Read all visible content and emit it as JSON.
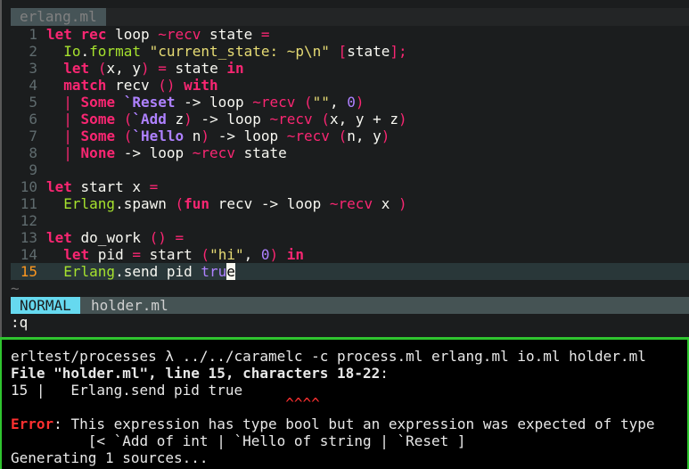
{
  "editor": {
    "tab_filename": "erlang.ml",
    "tilde": "~",
    "lines": [
      {
        "num": "1",
        "tokens": [
          {
            "t": "let",
            "c": "kw"
          },
          {
            "t": " "
          },
          {
            "t": "rec",
            "c": "kw"
          },
          {
            "t": " loop "
          },
          {
            "t": "~recv",
            "c": "op"
          },
          {
            "t": " state "
          },
          {
            "t": "=",
            "c": "op"
          }
        ]
      },
      {
        "num": "2",
        "tokens": [
          {
            "t": "  "
          },
          {
            "t": "Io",
            "c": "mod"
          },
          {
            "t": "."
          },
          {
            "t": "format",
            "c": "mod"
          },
          {
            "t": " "
          },
          {
            "t": "\"current_state: ~p\\n\"",
            "c": "str"
          },
          {
            "t": " "
          },
          {
            "t": "[",
            "c": "punc"
          },
          {
            "t": "state"
          },
          {
            "t": "];",
            "c": "punc"
          }
        ]
      },
      {
        "num": "3",
        "tokens": [
          {
            "t": "  "
          },
          {
            "t": "let",
            "c": "kw"
          },
          {
            "t": " "
          },
          {
            "t": "(",
            "c": "punc"
          },
          {
            "t": "x, y"
          },
          {
            "t": ")",
            "c": "punc"
          },
          {
            "t": " "
          },
          {
            "t": "=",
            "c": "op"
          },
          {
            "t": " state "
          },
          {
            "t": "in",
            "c": "kw"
          }
        ]
      },
      {
        "num": "4",
        "tokens": [
          {
            "t": "  "
          },
          {
            "t": "match",
            "c": "kw"
          },
          {
            "t": " recv "
          },
          {
            "t": "()",
            "c": "punc"
          },
          {
            "t": " "
          },
          {
            "t": "with",
            "c": "kw"
          }
        ]
      },
      {
        "num": "5",
        "tokens": [
          {
            "t": "  "
          },
          {
            "t": "|",
            "c": "op"
          },
          {
            "t": " "
          },
          {
            "t": "Some",
            "c": "kw"
          },
          {
            "t": " "
          },
          {
            "t": "`Reset",
            "c": "ctor"
          },
          {
            "t": " -> loop "
          },
          {
            "t": "~recv",
            "c": "op"
          },
          {
            "t": " "
          },
          {
            "t": "(",
            "c": "punc"
          },
          {
            "t": "\"\"",
            "c": "str"
          },
          {
            "t": ", "
          },
          {
            "t": "0",
            "c": "num"
          },
          {
            "t": ")",
            "c": "punc"
          }
        ]
      },
      {
        "num": "6",
        "tokens": [
          {
            "t": "  "
          },
          {
            "t": "|",
            "c": "op"
          },
          {
            "t": " "
          },
          {
            "t": "Some",
            "c": "kw"
          },
          {
            "t": " "
          },
          {
            "t": "(",
            "c": "punc"
          },
          {
            "t": "`Add",
            "c": "ctor"
          },
          {
            "t": " z"
          },
          {
            "t": ")",
            "c": "punc"
          },
          {
            "t": " -> loop "
          },
          {
            "t": "~recv",
            "c": "op"
          },
          {
            "t": " "
          },
          {
            "t": "(",
            "c": "punc"
          },
          {
            "t": "x, y + z"
          },
          {
            "t": ")",
            "c": "punc"
          }
        ]
      },
      {
        "num": "7",
        "tokens": [
          {
            "t": "  "
          },
          {
            "t": "|",
            "c": "op"
          },
          {
            "t": " "
          },
          {
            "t": "Some",
            "c": "kw"
          },
          {
            "t": " "
          },
          {
            "t": "(",
            "c": "punc"
          },
          {
            "t": "`Hello",
            "c": "ctor"
          },
          {
            "t": " n"
          },
          {
            "t": ")",
            "c": "punc"
          },
          {
            "t": " -> loop "
          },
          {
            "t": "~recv",
            "c": "op"
          },
          {
            "t": " "
          },
          {
            "t": "(",
            "c": "punc"
          },
          {
            "t": "n, y"
          },
          {
            "t": ")",
            "c": "punc"
          }
        ]
      },
      {
        "num": "8",
        "tokens": [
          {
            "t": "  "
          },
          {
            "t": "|",
            "c": "op"
          },
          {
            "t": " "
          },
          {
            "t": "None",
            "c": "kw"
          },
          {
            "t": " -> loop "
          },
          {
            "t": "~recv",
            "c": "op"
          },
          {
            "t": " state"
          }
        ]
      },
      {
        "num": "9",
        "tokens": []
      },
      {
        "num": "10",
        "tokens": [
          {
            "t": "let",
            "c": "kw"
          },
          {
            "t": " start x "
          },
          {
            "t": "=",
            "c": "op"
          }
        ]
      },
      {
        "num": "11",
        "tokens": [
          {
            "t": "  "
          },
          {
            "t": "Erlang",
            "c": "mod"
          },
          {
            "t": ".spawn "
          },
          {
            "t": "(",
            "c": "punc"
          },
          {
            "t": "fun",
            "c": "kw"
          },
          {
            "t": " recv -> loop "
          },
          {
            "t": "~recv",
            "c": "op"
          },
          {
            "t": " x "
          },
          {
            "t": ")",
            "c": "punc"
          }
        ]
      },
      {
        "num": "12",
        "tokens": []
      },
      {
        "num": "13",
        "tokens": [
          {
            "t": "let",
            "c": "kw"
          },
          {
            "t": " do_work "
          },
          {
            "t": "()",
            "c": "punc"
          },
          {
            "t": " "
          },
          {
            "t": "=",
            "c": "op"
          }
        ]
      },
      {
        "num": "14",
        "tokens": [
          {
            "t": "  "
          },
          {
            "t": "let",
            "c": "kw"
          },
          {
            "t": " pid "
          },
          {
            "t": "=",
            "c": "op"
          },
          {
            "t": " start "
          },
          {
            "t": "(",
            "c": "punc"
          },
          {
            "t": "\"hi\"",
            "c": "str"
          },
          {
            "t": ", "
          },
          {
            "t": "0",
            "c": "num"
          },
          {
            "t": ")",
            "c": "punc"
          },
          {
            "t": " "
          },
          {
            "t": "in",
            "c": "kw"
          }
        ]
      },
      {
        "num": "15",
        "current": true,
        "tokens": [
          {
            "t": "  "
          },
          {
            "t": "Erlang",
            "c": "mod"
          },
          {
            "t": ".send pid "
          },
          {
            "t": "tru",
            "c": "bool"
          },
          {
            "t": "e",
            "c": "cursor"
          }
        ]
      }
    ]
  },
  "statusline": {
    "mode": "NORMAL",
    "filename": "holder.ml"
  },
  "cmdline": ":q",
  "terminal": {
    "prompt_line": "erltest/processes λ ../../caramelc -c process.ml erlang.ml io.ml holder.ml",
    "file_loc": "File \"holder.ml\", line 15, characters 18-22",
    "file_loc_colon": ":",
    "source_line": "15 |   Erlang.send pid true",
    "carets": "                                ^^^^",
    "error_label": "Error",
    "error_msg": ": This expression has type bool but an expression was expected of type",
    "error_type": "         [< `Add of int | `Hello of string | `Reset ]",
    "generating": "Generating 1 sources..."
  }
}
